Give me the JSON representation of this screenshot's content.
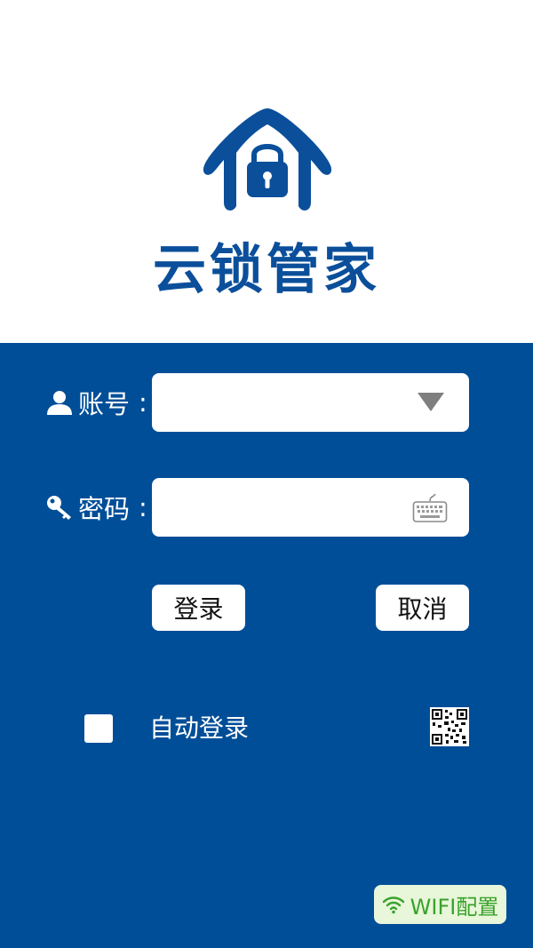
{
  "app": {
    "title": "云锁管家"
  },
  "account": {
    "label": "账号",
    "colon": ":",
    "value": "",
    "placeholder": ""
  },
  "password": {
    "label": "密码",
    "colon": ":",
    "value": "",
    "placeholder": ""
  },
  "buttons": {
    "login_label": "登录",
    "cancel_label": "取消"
  },
  "auto_login": {
    "label": "自动登录",
    "checked": false
  },
  "wifi": {
    "label": "WIFI配置"
  },
  "icons": {
    "logo": "house-lock-icon",
    "account": "user-icon",
    "password": "key-icon",
    "dropdown": "triangle-down-icon",
    "keyboard": "keyboard-icon",
    "qr": "qr-code-icon",
    "wifi": "wifi-icon"
  },
  "colors": {
    "brand_blue": "#004e98",
    "title_blue": "#0b4f9b",
    "wifi_green": "#3aa22d",
    "wifi_bg": "#e8f6d9"
  }
}
